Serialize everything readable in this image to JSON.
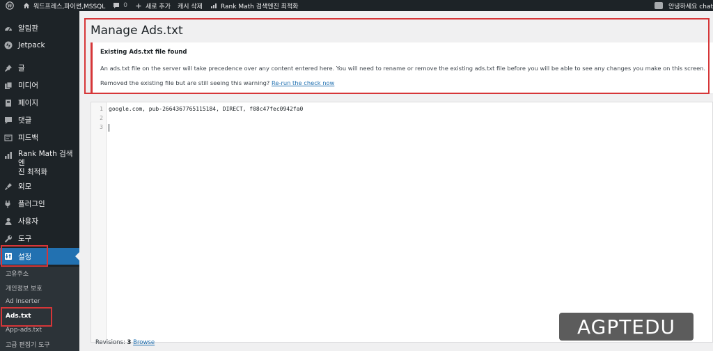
{
  "adminbar": {
    "site_name": "워드프레스,파이썬,MSSQL",
    "comments_count": "0",
    "new_label": "새로 추가",
    "cache_label": "캐시 삭제",
    "rankmath_label": "Rank Math 검색엔진 최적화",
    "greeting": "안녕하세요 chat"
  },
  "sidebar": {
    "items": [
      {
        "label": "알림판",
        "icon": "dashboard-icon"
      },
      {
        "label": "Jetpack",
        "icon": "jetpack-icon"
      },
      {
        "label": "글",
        "icon": "pin-icon"
      },
      {
        "label": "미디어",
        "icon": "media-icon"
      },
      {
        "label": "페이지",
        "icon": "page-icon"
      },
      {
        "label": "댓글",
        "icon": "comment-icon"
      },
      {
        "label": "피드백",
        "icon": "feedback-icon"
      },
      {
        "label": "Rank Math 검색엔",
        "label2": "진 최적화",
        "icon": "rankmath-icon"
      },
      {
        "label": "외모",
        "icon": "brush-icon"
      },
      {
        "label": "플러그인",
        "icon": "plugin-icon"
      },
      {
        "label": "사용자",
        "icon": "user-icon"
      },
      {
        "label": "도구",
        "icon": "wrench-icon"
      },
      {
        "label": "설정",
        "icon": "settings-icon"
      }
    ],
    "submenu": [
      "고유주소",
      "개인정보 보호",
      "Ad Inserter",
      "Ads.txt",
      "App-ads.txt",
      "고급 편집기 도구"
    ]
  },
  "main": {
    "title": "Manage Ads.txt",
    "notice": {
      "heading": "Existing Ads.txt file found",
      "body": "An ads.txt file on the server will take precedence over any content entered here. You will need to rename or remove the existing ads.txt file before you will be able to see any changes you make on this screen.",
      "foot_text": "Removed the existing file but are still seeing this warning?",
      "foot_link": "Re-run the check now"
    },
    "editor": {
      "line_numbers": [
        "1",
        "2",
        "3"
      ],
      "lines": [
        "google.com, pub-2664367765115184, DIRECT, f08c47fec0942fa0",
        "",
        ""
      ]
    },
    "revisions": {
      "label": "Revisions:",
      "count": "3",
      "link": "Browse"
    }
  },
  "watermark": "AGPTEDU",
  "colors": {
    "adminbar_bg": "#1d2327",
    "sidebar_bg": "#1d2327",
    "submenu_bg": "#2c3338",
    "accent": "#2271b1",
    "notice_error": "#d63638",
    "annotation_red": "#d63638"
  }
}
